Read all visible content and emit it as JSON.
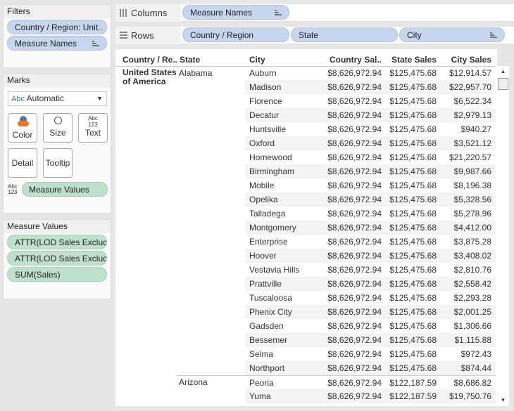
{
  "filters": {
    "title": "Filters",
    "items": [
      "Country / Region: Unit..",
      "Measure Names"
    ]
  },
  "marks": {
    "title": "Marks",
    "type": "Automatic",
    "buttons": [
      "Color",
      "Size",
      "Text",
      "Detail",
      "Tooltip"
    ],
    "text_pill": "Measure Values"
  },
  "measure_values": {
    "title": "Measure Values",
    "items": [
      "ATTR(LOD Sales Exclud..",
      "ATTR(LOD Sales Exclud..",
      "SUM(Sales)"
    ]
  },
  "columns": {
    "label": "Columns",
    "pills": [
      "Measure Names"
    ]
  },
  "rows": {
    "label": "Rows",
    "pills": [
      "Country / Region",
      "State",
      "City"
    ]
  },
  "table": {
    "headers": [
      "Country / Re..",
      "State",
      "City",
      "Country Sal..",
      "State Sales",
      "City Sales"
    ],
    "country": "United States of America",
    "rows": [
      [
        "Alabama",
        "Auburn",
        "$8,626,972.94",
        "$125,475.68",
        "$12,914.57"
      ],
      [
        "",
        "Madison",
        "$8,626,972.94",
        "$125,475.68",
        "$22,957.70"
      ],
      [
        "",
        "Florence",
        "$8,626,972.94",
        "$125,475.68",
        "$6,522.34"
      ],
      [
        "",
        "Decatur",
        "$8,626,972.94",
        "$125,475.68",
        "$2,979.13"
      ],
      [
        "",
        "Huntsville",
        "$8,626,972.94",
        "$125,475.68",
        "$940.27"
      ],
      [
        "",
        "Oxford",
        "$8,626,972.94",
        "$125,475.68",
        "$3,521.12"
      ],
      [
        "",
        "Homewood",
        "$8,626,972.94",
        "$125,475.68",
        "$21,220.57"
      ],
      [
        "",
        "Birmingham",
        "$8,626,972.94",
        "$125,475.68",
        "$9,987.66"
      ],
      [
        "",
        "Mobile",
        "$8,626,972.94",
        "$125,475.68",
        "$8,196.38"
      ],
      [
        "",
        "Opelika",
        "$8,626,972.94",
        "$125,475.68",
        "$5,328.56"
      ],
      [
        "",
        "Talladega",
        "$8,626,972.94",
        "$125,475.68",
        "$5,278.96"
      ],
      [
        "",
        "Montgomery",
        "$8,626,972.94",
        "$125,475.68",
        "$4,412.00"
      ],
      [
        "",
        "Enterprise",
        "$8,626,972.94",
        "$125,475.68",
        "$3,875.28"
      ],
      [
        "",
        "Hoover",
        "$8,626,972.94",
        "$125,475.68",
        "$3,408.02"
      ],
      [
        "",
        "Vestavia Hills",
        "$8,626,972.94",
        "$125,475.68",
        "$2,810.76"
      ],
      [
        "",
        "Prattville",
        "$8,626,972.94",
        "$125,475.68",
        "$2,558.42"
      ],
      [
        "",
        "Tuscaloosa",
        "$8,626,972.94",
        "$125,475.68",
        "$2,293.28"
      ],
      [
        "",
        "Phenix City",
        "$8,626,972.94",
        "$125,475.68",
        "$2,001.25"
      ],
      [
        "",
        "Gadsden",
        "$8,626,972.94",
        "$125,475.68",
        "$1,306.66"
      ],
      [
        "",
        "Bessemer",
        "$8,626,972.94",
        "$125,475.68",
        "$1,115.88"
      ],
      [
        "",
        "Selma",
        "$8,626,972.94",
        "$125,475.68",
        "$972.43"
      ],
      [
        "",
        "Northport",
        "$8,626,972.94",
        "$125,475.68",
        "$874.44"
      ],
      [
        "Arizona",
        "Peoria",
        "$8,626,972.94",
        "$122,187.59",
        "$8,686.82"
      ],
      [
        "",
        "Yuma",
        "$8,626,972.94",
        "$122,187.59",
        "$19,750.76"
      ]
    ]
  }
}
